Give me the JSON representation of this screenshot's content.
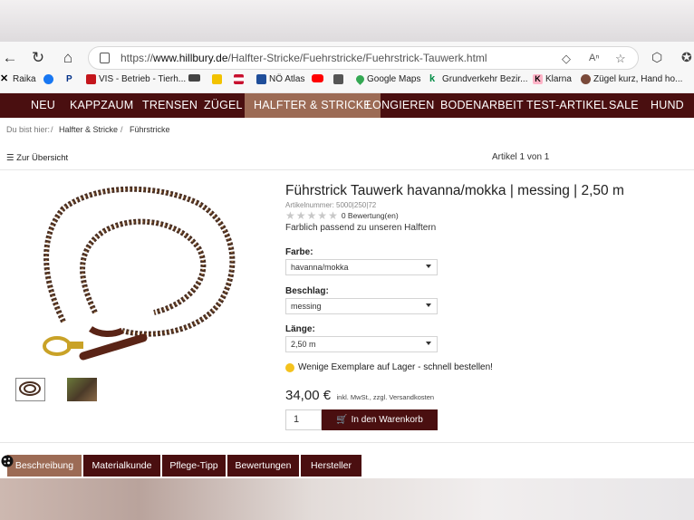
{
  "browser": {
    "url_prefix": "https://",
    "url_domain": "www.hillbury.de",
    "url_path": "/Halfter-Stricke/Fuehrstricke/Fuehrstrick-Tauwerk.html"
  },
  "bookmarks": [
    {
      "label": "Raika",
      "icon": "raika-icon",
      "color": "#f2c200"
    },
    {
      "label": "",
      "icon": "facebook-icon",
      "color": "#1877f2"
    },
    {
      "label": "",
      "icon": "paypal-icon",
      "color": "#003087"
    },
    {
      "label": "VIS - Betrieb - Tierh...",
      "icon": "vis-icon",
      "color": "#c4161c"
    },
    {
      "label": "",
      "icon": "bookmark-icon-1",
      "color": "#444"
    },
    {
      "label": "",
      "icon": "bookmark-icon-2",
      "color": "#f2c200"
    },
    {
      "label": "",
      "icon": "austria-flag-icon",
      "color": "#c8102e"
    },
    {
      "label": "NÖ Atlas",
      "icon": "noe-atlas-icon",
      "color": "#1f4e9a"
    },
    {
      "label": "",
      "icon": "youtube-icon",
      "color": "#ff0000"
    },
    {
      "label": "",
      "icon": "qr-icon",
      "color": "#555"
    },
    {
      "label": "Google Maps",
      "icon": "google-maps-icon",
      "color": "#34a853"
    },
    {
      "label": "Grundverkehr Bezir...",
      "icon": "grundverkehr-icon",
      "color": "#008c45"
    },
    {
      "label": "Klarna",
      "icon": "klarna-icon",
      "color": "#ffb3c7"
    },
    {
      "label": "Zügel kurz, Hand ho...",
      "icon": "zuegel-icon",
      "color": "#7a4a3a"
    }
  ],
  "nav": {
    "items": [
      "NEU",
      "KAPPZAUM",
      "TRENSEN",
      "ZÜGEL",
      "HALFTER & STRICKE",
      "LONGIEREN",
      "BODENARBEIT",
      "TEST-ARTIKEL",
      "SALE",
      "HUND"
    ],
    "active": "HALFTER & STRICKE"
  },
  "breadcrumb": {
    "prefix": "Du bist hier:",
    "sep": "/",
    "items": [
      "Halfter & Stricke",
      "Führstricke"
    ]
  },
  "toolbar": {
    "back_label": "Zur Übersicht",
    "count_label": "Artikel 1 von 1"
  },
  "product": {
    "title": "Führstrick Tauwerk havanna/mokka | messing | 2,50 m",
    "article_number": "Artikelnummer: 5000|250|72",
    "rating": 0,
    "reviews_label": "0 Bewertung(en)",
    "description": "Farblich passend zu unseren Halftern",
    "options": [
      {
        "label": "Farbe:",
        "value": "havanna/mokka"
      },
      {
        "label": "Beschlag:",
        "value": "messing"
      },
      {
        "label": "Länge:",
        "value": "2,50 m"
      }
    ],
    "stock_text": "Wenige Exemplare auf Lager - schnell bestellen!",
    "price": "34,00 €",
    "tax_note": "inkl. MwSt., zzgl. Versandkosten",
    "quantity": "1",
    "cart_label": "In den Warenkorb"
  },
  "tabs": [
    "Beschreibung",
    "Materialkunde",
    "Pflege-Tipp",
    "Bewertungen",
    "Hersteller"
  ],
  "colors": {
    "brand": "#4a0f10",
    "active": "#9c6b55",
    "stock_dot": "#f4c21d"
  }
}
